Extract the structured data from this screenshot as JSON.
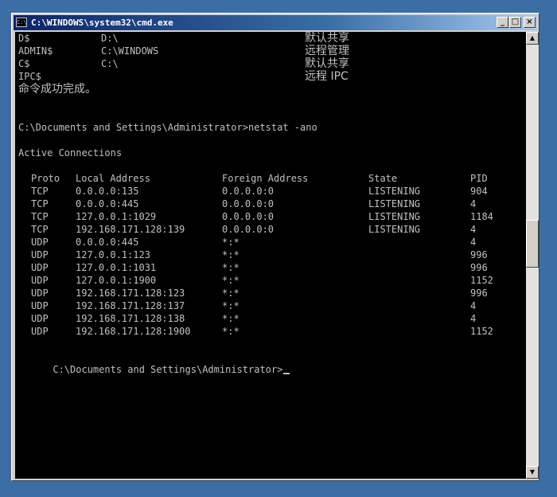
{
  "window": {
    "title": "C:\\WINDOWS\\system32\\cmd.exe",
    "icon_text": "C:\\",
    "buttons": {
      "minimize": "_",
      "maximize": "□",
      "close": "×"
    }
  },
  "shares": [
    {
      "name": "D$",
      "path": "D:\\",
      "remark": "默认共享"
    },
    {
      "name": "ADMIN$",
      "path": "C:\\WINDOWS",
      "remark": "远程管理"
    },
    {
      "name": "C$",
      "path": "C:\\",
      "remark": "默认共享"
    },
    {
      "name": "IPC$",
      "path": "",
      "remark": "远程 IPC"
    }
  ],
  "success_message": "命令成功完成。",
  "prompt1": "C:\\Documents and Settings\\Administrator>netstat -ano",
  "active_header": "Active Connections",
  "netstat": {
    "headers": {
      "proto": "Proto",
      "local": "Local Address",
      "foreign": "Foreign Address",
      "state": "State",
      "pid": "PID"
    },
    "rows": [
      {
        "proto": "TCP",
        "local": "0.0.0.0:135",
        "foreign": "0.0.0.0:0",
        "state": "LISTENING",
        "pid": "904"
      },
      {
        "proto": "TCP",
        "local": "0.0.0.0:445",
        "foreign": "0.0.0.0:0",
        "state": "LISTENING",
        "pid": "4"
      },
      {
        "proto": "TCP",
        "local": "127.0.0.1:1029",
        "foreign": "0.0.0.0:0",
        "state": "LISTENING",
        "pid": "1184"
      },
      {
        "proto": "TCP",
        "local": "192.168.171.128:139",
        "foreign": "0.0.0.0:0",
        "state": "LISTENING",
        "pid": "4"
      },
      {
        "proto": "UDP",
        "local": "0.0.0.0:445",
        "foreign": "*:*",
        "state": "",
        "pid": "4"
      },
      {
        "proto": "UDP",
        "local": "127.0.0.1:123",
        "foreign": "*:*",
        "state": "",
        "pid": "996"
      },
      {
        "proto": "UDP",
        "local": "127.0.0.1:1031",
        "foreign": "*:*",
        "state": "",
        "pid": "996"
      },
      {
        "proto": "UDP",
        "local": "127.0.0.1:1900",
        "foreign": "*:*",
        "state": "",
        "pid": "1152"
      },
      {
        "proto": "UDP",
        "local": "192.168.171.128:123",
        "foreign": "*:*",
        "state": "",
        "pid": "996"
      },
      {
        "proto": "UDP",
        "local": "192.168.171.128:137",
        "foreign": "*:*",
        "state": "",
        "pid": "4"
      },
      {
        "proto": "UDP",
        "local": "192.168.171.128:138",
        "foreign": "*:*",
        "state": "",
        "pid": "4"
      },
      {
        "proto": "UDP",
        "local": "192.168.171.128:1900",
        "foreign": "*:*",
        "state": "",
        "pid": "1152"
      }
    ]
  },
  "prompt2": "C:\\Documents and Settings\\Administrator>",
  "scrollbar": {
    "up_arrow": "▲",
    "down_arrow": "▼"
  }
}
